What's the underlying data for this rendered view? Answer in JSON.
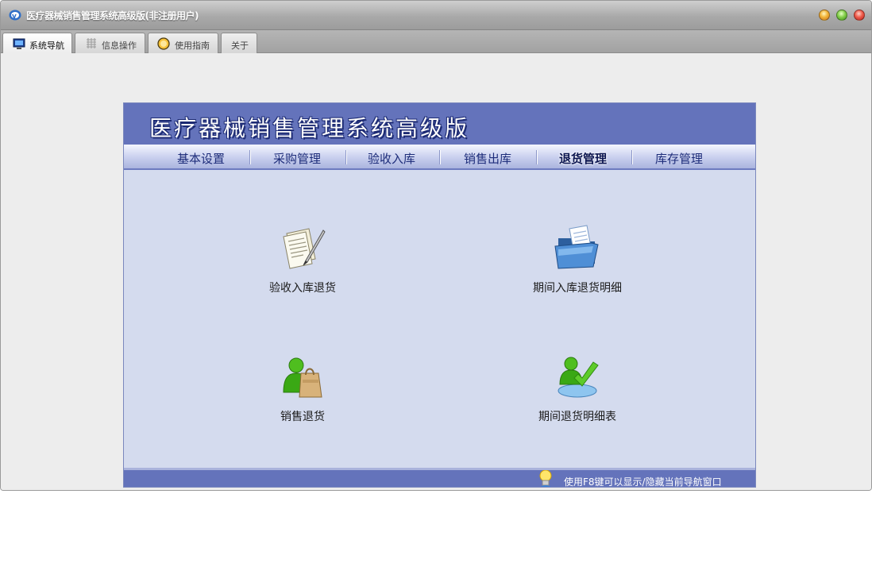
{
  "window": {
    "title": "医疗器械销售管理系统高级版(非注册用户)"
  },
  "tabs": [
    {
      "label": "系统导航",
      "icon": "monitor-icon",
      "active": true
    },
    {
      "label": "信息操作",
      "icon": "grid-icon",
      "active": false
    },
    {
      "label": "使用指南",
      "icon": "help-icon",
      "active": false
    },
    {
      "label": "关于",
      "icon": "",
      "active": false
    }
  ],
  "panel": {
    "banner_title": "医疗器械销售管理系统高级版",
    "menu": [
      {
        "label": "基本设置",
        "active": false
      },
      {
        "label": "采购管理",
        "active": false
      },
      {
        "label": "验收入库",
        "active": false
      },
      {
        "label": "销售出库",
        "active": false
      },
      {
        "label": "退货管理",
        "active": true
      },
      {
        "label": "库存管理",
        "active": false
      }
    ],
    "items": [
      {
        "label": "验收入库退货",
        "icon": "document-pen-icon"
      },
      {
        "label": "期间入库退货明细",
        "icon": "open-folder-icon"
      },
      {
        "label": "销售退货",
        "icon": "user-shopping-bag-icon"
      },
      {
        "label": "期间退货明细表",
        "icon": "user-checkmark-icon"
      }
    ],
    "footer_hint": "使用F8键可以显示/隐藏当前导航窗口"
  },
  "colors": {
    "banner": "#6473bb",
    "panel_bg": "#d4dbee",
    "menu_text": "#1e2d7a"
  }
}
